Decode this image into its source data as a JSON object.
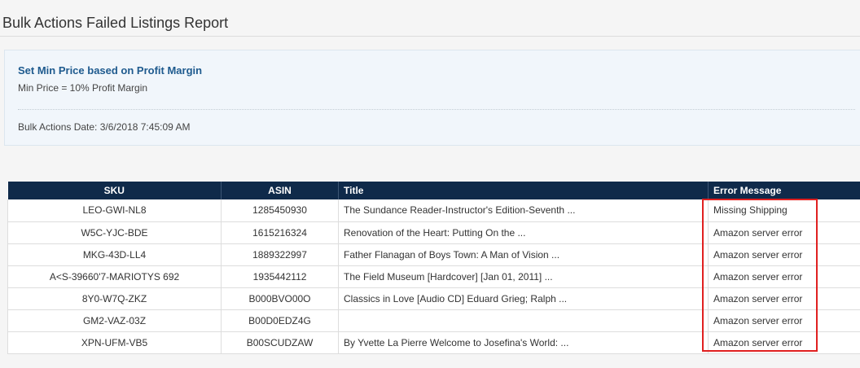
{
  "page": {
    "title": "Bulk Actions Failed Listings Report"
  },
  "info": {
    "action_name": "Set Min Price based on Profit Margin",
    "action_rule": "Min Price = 10% Profit Margin",
    "bulk_date": "Bulk Actions Date: 3/6/2018 7:45:09 AM"
  },
  "table": {
    "columns": [
      "SKU",
      "ASIN",
      "Title",
      "Error Message"
    ],
    "rows": [
      {
        "sku": "LEO-GWI-NL8",
        "asin": "1285450930",
        "title": "The Sundance Reader-Instructor's Edition-Seventh ...",
        "error": "Missing Shipping"
      },
      {
        "sku": "W5C-YJC-BDE",
        "asin": "1615216324",
        "title": "Renovation of the Heart: Putting On the ...",
        "error": "Amazon server error"
      },
      {
        "sku": "MKG-43D-LL4",
        "asin": "1889322997",
        "title": "Father Flanagan of Boys Town: A Man of Vision ...",
        "error": "Amazon server error"
      },
      {
        "sku": "A<S-39660'7-MARIOTYS 692",
        "asin": "1935442112",
        "title": "The Field Museum [Hardcover] [Jan 01, 2011] ...",
        "error": "Amazon server error"
      },
      {
        "sku": "8Y0-W7Q-ZKZ",
        "asin": "B000BVO00O",
        "title": "Classics in Love [Audio CD] Eduard Grieg; Ralph ...",
        "error": "Amazon server error"
      },
      {
        "sku": "GM2-VAZ-03Z",
        "asin": "B00D0EDZ4G",
        "title": "",
        "error": "Amazon server error"
      },
      {
        "sku": "XPN-UFM-VB5",
        "asin": "B00SCUDZAW",
        "title": "By Yvette La Pierre Welcome to Josefina's World: ...",
        "error": "Amazon server error"
      }
    ]
  },
  "colors": {
    "header_bg": "#0f2a4a",
    "action_title": "#1e5a8e",
    "highlight": "#e02020"
  }
}
